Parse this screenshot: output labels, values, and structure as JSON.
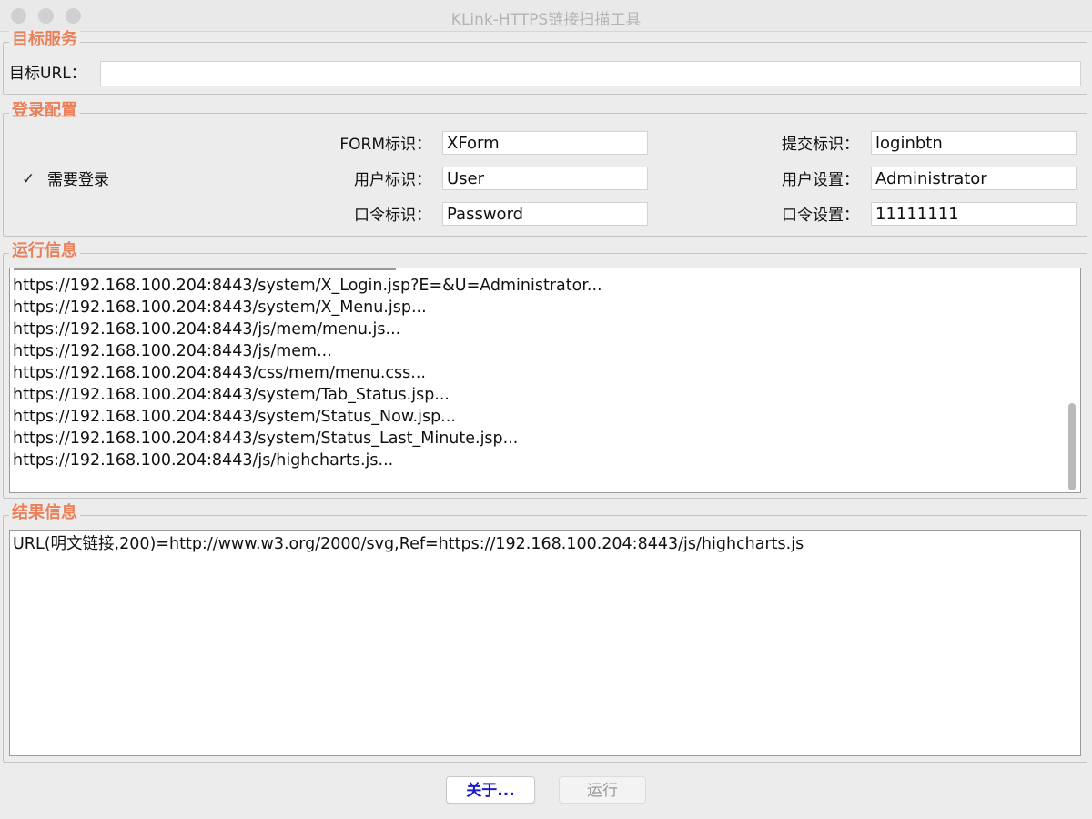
{
  "window": {
    "title": "KLink-HTTPS链接扫描工具"
  },
  "target_service": {
    "group_title": "目标服务",
    "url_label": "目标URL：",
    "url_value": ""
  },
  "login_config": {
    "group_title": "登录配置",
    "need_login_label": "需要登录",
    "need_login_checked": true,
    "form_id_label": "FORM标识：",
    "form_id_value": "XForm",
    "user_id_label": "用户标识：",
    "user_id_value": "User",
    "password_id_label": "口令标识：",
    "password_id_value": "Password",
    "submit_id_label": "提交标识：",
    "submit_id_value": "loginbtn",
    "user_setting_label": "用户设置：",
    "user_setting_value": "Administrator",
    "password_setting_label": "口令设置：",
    "password_setting_value": "11111111"
  },
  "run_info": {
    "group_title": "运行信息",
    "lines": [
      "https://192.168.100.204:8443/system/X_Login.jsp?E=&U=Administrator...",
      "https://192.168.100.204:8443/system/X_Menu.jsp...",
      "https://192.168.100.204:8443/js/mem/menu.js...",
      "https://192.168.100.204:8443/js/mem...",
      "https://192.168.100.204:8443/css/mem/menu.css...",
      "https://192.168.100.204:8443/system/Tab_Status.jsp...",
      "https://192.168.100.204:8443/system/Status_Now.jsp...",
      "https://192.168.100.204:8443/system/Status_Last_Minute.jsp...",
      "https://192.168.100.204:8443/js/highcharts.js..."
    ]
  },
  "result_info": {
    "group_title": "结果信息",
    "lines": [
      "URL(明文链接,200)=http://www.w3.org/2000/svg,Ref=https://192.168.100.204:8443/js/highcharts.js"
    ]
  },
  "buttons": {
    "about": "关于...",
    "run": "运行"
  }
}
